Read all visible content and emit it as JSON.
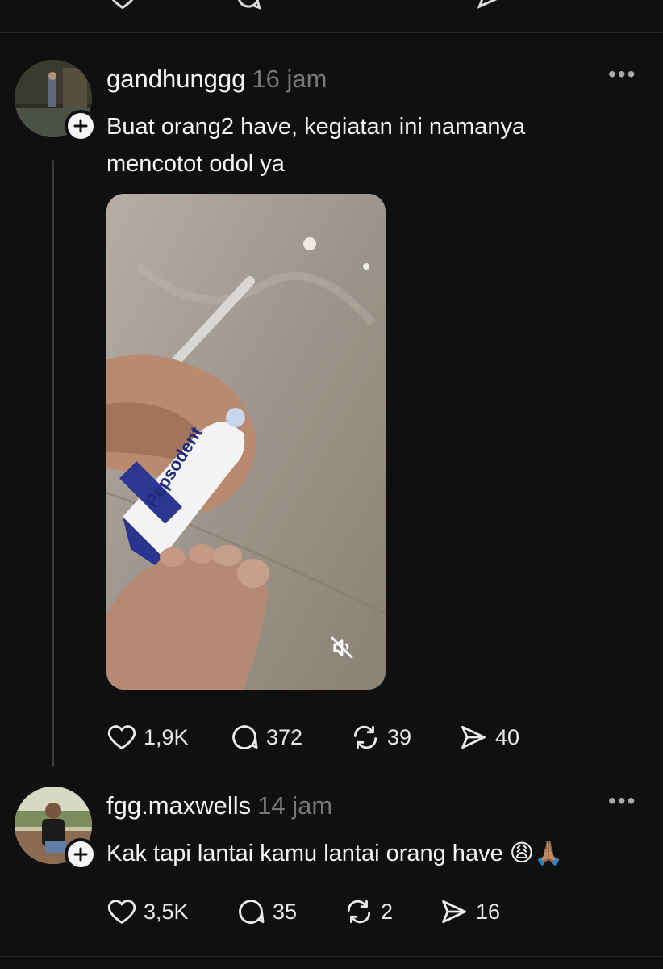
{
  "top_partial": {
    "note": ""
  },
  "post": {
    "username": "gandhunggg",
    "time": "16 jam",
    "text_line1": "Buat orang2 have, kegiatan ini namanya",
    "text_line2": "mencotot odol ya",
    "media_label": "Pepsodent",
    "actions": {
      "likes": "1,9K",
      "comments": "372",
      "reposts": "39",
      "shares": "40"
    }
  },
  "reply": {
    "username": "fgg.maxwells",
    "time": "14 jam",
    "text": "Kak tapi lantai kamu lantai orang have 😩🙏🏽",
    "actions": {
      "likes": "3,5K",
      "comments": "35",
      "reposts": "2",
      "shares": "16"
    }
  },
  "icons": {
    "like": "heart-icon",
    "comment": "comment-bubble-icon",
    "repost": "repost-icon",
    "share": "send-icon",
    "more": "more-dots-icon",
    "mute": "muted-speaker-icon",
    "follow": "plus-icon"
  }
}
